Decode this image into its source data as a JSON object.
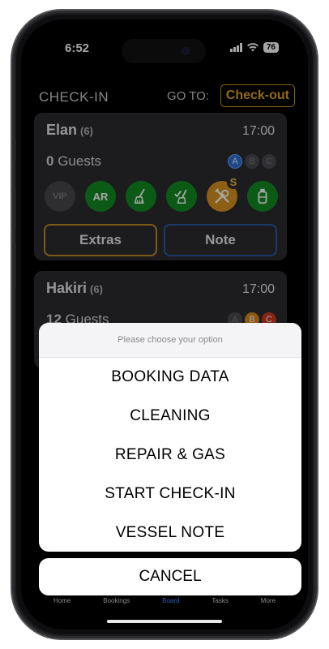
{
  "status_bar": {
    "time": "6:52",
    "battery": "76"
  },
  "header": {
    "title": "CHECK-IN",
    "goto_label": "GO TO:",
    "checkout_button": "Check-out"
  },
  "cards": [
    {
      "name": "Elan",
      "count": "(6)",
      "time": "17:00",
      "guests_count": "0",
      "guests_label": "Guests",
      "groups": [
        "A",
        "B",
        "C"
      ],
      "icons": [
        {
          "icon": "vip-icon",
          "label": "VIP",
          "state": "inactive"
        },
        {
          "icon": "ar-icon",
          "label": "AR",
          "state": "active"
        },
        {
          "icon": "broom-icon",
          "label": "",
          "state": "active"
        },
        {
          "icon": "cleaning-check-icon",
          "label": "",
          "state": "active"
        },
        {
          "icon": "repair-tools-icon",
          "label": "",
          "badge": "S",
          "state": "warning"
        },
        {
          "icon": "gas-bottle-icon",
          "label": "",
          "state": "active"
        }
      ],
      "extras_button": "Extras",
      "note_button": "Note"
    },
    {
      "name": "Hakiri",
      "count": "(6)",
      "time": "17:00",
      "guests_count": "12",
      "guests_label": "Guests",
      "groups": [
        "A",
        "B",
        "C"
      ]
    }
  ],
  "action_sheet": {
    "title": "Please choose your option",
    "options": [
      "BOOKING DATA",
      "CLEANING",
      "REPAIR & GAS",
      "START CHECK-IN",
      "VESSEL NOTE"
    ],
    "cancel": "CANCEL"
  },
  "tab_bar": {
    "items": [
      "Home",
      "Bookings",
      "Board",
      "Tasks",
      "More"
    ],
    "active": "Board"
  },
  "colors": {
    "accent_orange": "#e0a32e",
    "active_green": "#128c23",
    "note_blue": "#2a5aa6"
  }
}
